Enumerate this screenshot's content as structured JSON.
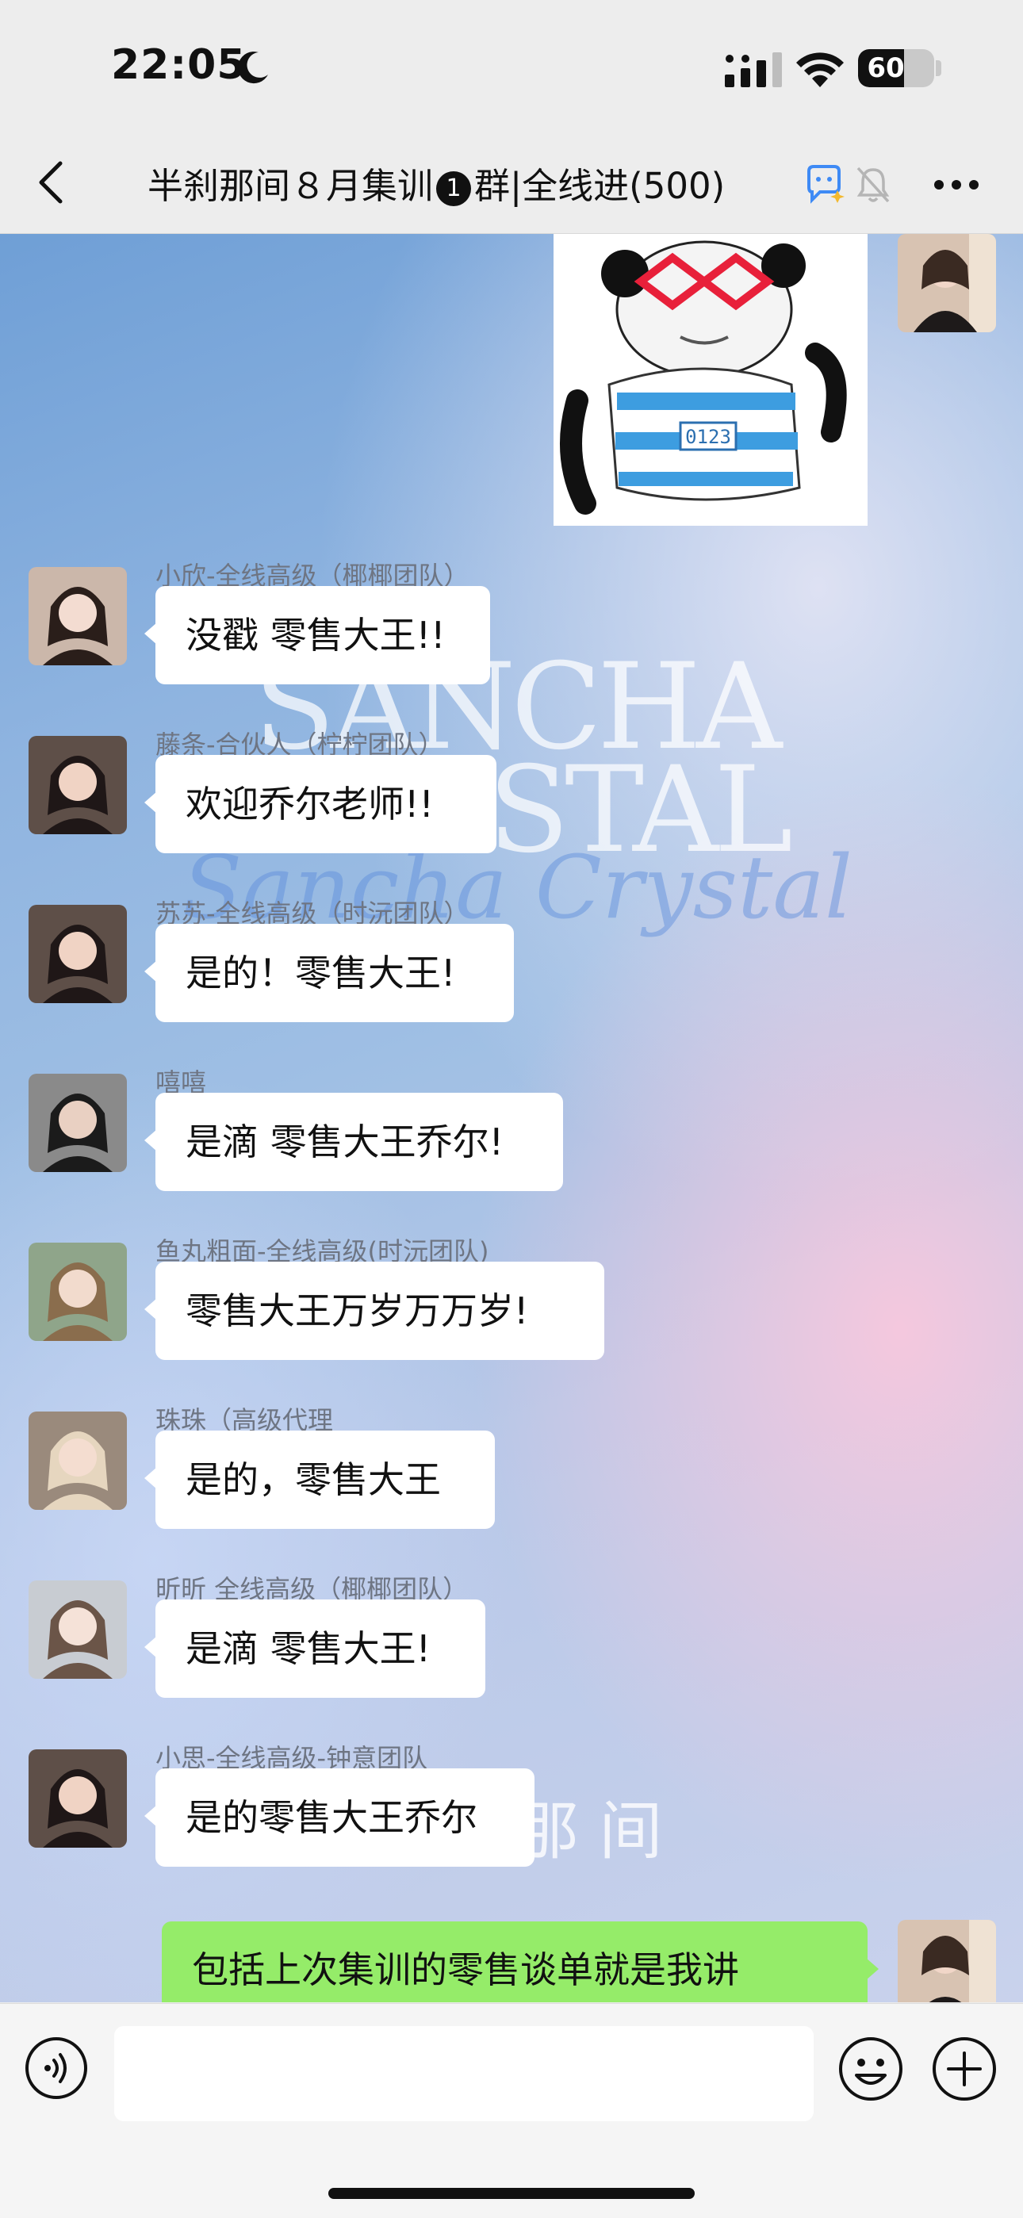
{
  "status_bar": {
    "time": "22:05",
    "battery": "60",
    "battery_level": 0.6,
    "icons": [
      "moon-icon",
      "signal-icon",
      "wifi-icon",
      "battery-icon"
    ]
  },
  "nav": {
    "title_part1": "半刹那间８月集训",
    "title_badge": "1",
    "title_part2": "群|全线进(500)",
    "icons": [
      "back-icon",
      "ai-icon",
      "mute-bell-icon",
      "more-icon"
    ]
  },
  "background": {
    "watermark1": "SANCHA",
    "watermark2": "RYSTAL",
    "watermark3": "Sancha Crystal",
    "watermark4": "那 间"
  },
  "messages": [
    {
      "sender": "小欣-全线高级（椰椰团队）",
      "text": "没戳 零售大王!!"
    },
    {
      "sender": "藤条-合伙人（柠柠团队）",
      "text": "欢迎乔尔老师!!"
    },
    {
      "sender": "苏苏-全线高级（时沅团队）",
      "text": "是的！零售大王!"
    },
    {
      "sender": "嘻嘻",
      "text": "是滴 零售大王乔尔!"
    },
    {
      "sender": "鱼丸粗面-全线高级(时沅团队)",
      "text": "零售大王万岁万万岁!"
    },
    {
      "sender": "珠珠（高级代理",
      "text": "是的，零售大王"
    },
    {
      "sender": "昕昕 全线高级（椰椰团队）",
      "text": "是滴 零售大王!"
    },
    {
      "sender": "小思-全线高级-钟意团队",
      "text": "是的零售大王乔尔"
    }
  ],
  "own_message": {
    "text": "包括上次集训的零售谈单就是我讲"
  },
  "sticker": {
    "label": "0123"
  },
  "colors": {
    "accent_green": "#95ec69",
    "bubble_white": "#ffffff",
    "bar_bg": "#ededed"
  },
  "input_bar": {
    "icons": [
      "voice-icon",
      "emoji-icon",
      "plus-icon"
    ]
  }
}
